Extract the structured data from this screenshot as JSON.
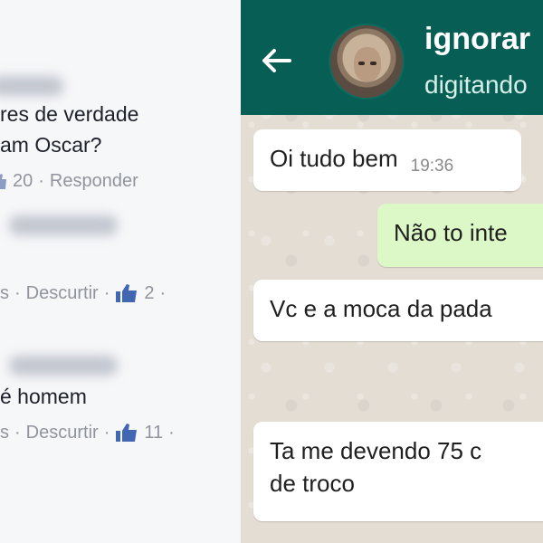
{
  "facebook": {
    "comments": [
      {
        "name_blurred": "Marcia",
        "text_line1": "res de verdade",
        "text_line2": "am Oscar?",
        "likes": "20",
        "reply_label": "Responder"
      },
      {
        "name_blurred": "Santos",
        "meta_prefix": "s",
        "unlike_label": "Descurtir",
        "likes": "2"
      },
      {
        "name_blurred": "Santos",
        "text_line1": "é homem",
        "meta_prefix": "s",
        "unlike_label": "Descurtir",
        "likes": "11"
      }
    ],
    "colors": {
      "text": "#1d2129",
      "meta": "#90949c",
      "like_blue": "#4267b2"
    }
  },
  "whatsapp": {
    "header": {
      "contact_name": "ignorar",
      "status": "digitando"
    },
    "messages": [
      {
        "direction": "in",
        "text": "Oi tudo bem",
        "time": "19:36"
      },
      {
        "direction": "out",
        "text": "Não to inte"
      },
      {
        "direction": "in",
        "text": "Vc e a moca da pada"
      },
      {
        "direction": "in",
        "line1": "Ta me devendo 75 c",
        "line2": "de troco"
      }
    ],
    "colors": {
      "header": "#075e54",
      "incoming": "#ffffff",
      "outgoing": "#dcf8c6",
      "background": "#e4ddd4"
    },
    "icons": {
      "back": "back-arrow-icon"
    }
  }
}
